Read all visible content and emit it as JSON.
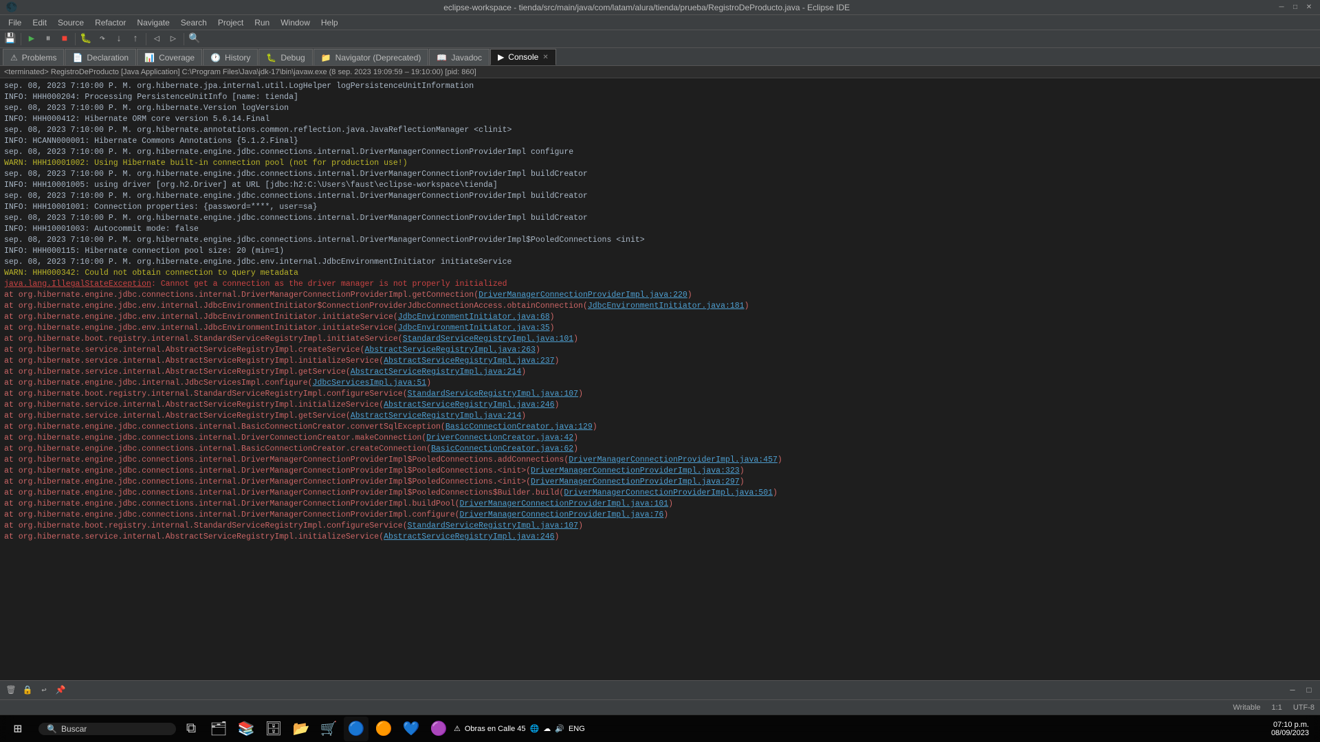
{
  "titlebar": {
    "title": "eclipse-workspace - tienda/src/main/java/com/latam/alura/tienda/prueba/RegistroDeProducto.java - Eclipse IDE",
    "minimize": "─",
    "maximize": "□",
    "close": "✕"
  },
  "menubar": {
    "items": [
      "File",
      "Edit",
      "Source",
      "Refactor",
      "Navigate",
      "Search",
      "Project",
      "Run",
      "Window",
      "Help"
    ]
  },
  "tabs": [
    {
      "id": "problems",
      "label": "Problems",
      "icon": "⚠",
      "active": false
    },
    {
      "id": "declaration",
      "label": "Declaration",
      "icon": "📄",
      "active": false
    },
    {
      "id": "coverage",
      "label": "Coverage",
      "icon": "📊",
      "active": false
    },
    {
      "id": "history",
      "label": "History",
      "icon": "🕐",
      "active": false
    },
    {
      "id": "debug",
      "label": "Debug",
      "icon": "🐛",
      "active": false
    },
    {
      "id": "navigator",
      "label": "Navigator (Deprecated)",
      "icon": "📁",
      "active": false
    },
    {
      "id": "javadoc",
      "label": "Javadoc",
      "icon": "📖",
      "active": false
    },
    {
      "id": "console",
      "label": "Console",
      "icon": "▶",
      "active": true
    }
  ],
  "process_bar": {
    "text": "<terminated> RegistroDeProducto [Java Application] C:\\Program Files\\Java\\jdk-17\\bin\\javaw.exe  (8 sep. 2023 19:09:59 – 19:10:00) [pid: 860]"
  },
  "console": {
    "lines": [
      {
        "type": "info",
        "text": "sep. 08, 2023 7:10:00 P. M. org.hibernate.jpa.internal.util.LogHelper logPersistenceUnitInformation"
      },
      {
        "type": "info",
        "text": "INFO: HHH000204: Processing PersistenceUnitInfo [name: tienda]"
      },
      {
        "type": "info",
        "text": "sep. 08, 2023 7:10:00 P. M. org.hibernate.Version logVersion"
      },
      {
        "type": "info",
        "text": "INFO: HHH000412: Hibernate ORM core version 5.6.14.Final"
      },
      {
        "type": "info",
        "text": "sep. 08, 2023 7:10:00 P. M. org.hibernate.annotations.common.reflection.java.JavaReflectionManager <clinit>"
      },
      {
        "type": "info",
        "text": "INFO: HCANN000001: Hibernate Commons Annotations {5.1.2.Final}"
      },
      {
        "type": "info",
        "text": "sep. 08, 2023 7:10:00 P. M. org.hibernate.engine.jdbc.connections.internal.DriverManagerConnectionProviderImpl configure"
      },
      {
        "type": "warn",
        "text": "WARN: HHH10001002: Using Hibernate built-in connection pool (not for production use!)"
      },
      {
        "type": "info",
        "text": "sep. 08, 2023 7:10:00 P. M. org.hibernate.engine.jdbc.connections.internal.DriverManagerConnectionProviderImpl buildCreator"
      },
      {
        "type": "info",
        "text": "INFO: HHH10001005: using driver [org.h2.Driver] at URL [jdbc:h2:C:\\Users\\faust\\eclipse-workspace\\tienda]"
      },
      {
        "type": "info",
        "text": "sep. 08, 2023 7:10:00 P. M. org.hibernate.engine.jdbc.connections.internal.DriverManagerConnectionProviderImpl buildCreator"
      },
      {
        "type": "info",
        "text": "INFO: HHH10001001: Connection properties: {password=****, user=sa}"
      },
      {
        "type": "info",
        "text": "sep. 08, 2023 7:10:00 P. M. org.hibernate.engine.jdbc.connections.internal.DriverManagerConnectionProviderImpl buildCreator"
      },
      {
        "type": "info",
        "text": "INFO: HHH10001003: Autocommit mode: false"
      },
      {
        "type": "info",
        "text": "sep. 08, 2023 7:10:00 P. M. org.hibernate.engine.jdbc.connections.internal.DriverManagerConnectionProviderImpl$PooledConnections <init>"
      },
      {
        "type": "info",
        "text": "INFO: HHH000115: Hibernate connection pool size: 20 (min=1)"
      },
      {
        "type": "info",
        "text": "sep. 08, 2023 7:10:00 P. M. org.hibernate.engine.jdbc.env.internal.JdbcEnvironmentInitiator initiateService"
      },
      {
        "type": "warn",
        "text": "WARN: HHH000342: Could not obtain connection to query metadata"
      },
      {
        "type": "error-header",
        "text": "java.lang.IllegalStateException: Cannot get a connection as the driver manager is not properly initialized"
      },
      {
        "type": "stack",
        "text": "    at org.hibernate.engine.jdbc.connections.internal.DriverManagerConnectionProviderImpl.getConnection(",
        "link": "DriverManagerConnectionProviderImpl.java:220",
        "suffix": ")"
      },
      {
        "type": "stack",
        "text": "    at org.hibernate.engine.jdbc.env.internal.JdbcEnvironmentInitiator$ConnectionProviderJdbcConnectionAccess.obtainConnection(",
        "link": "JdbcEnvironmentInitiator.java:181",
        "suffix": ")"
      },
      {
        "type": "stack",
        "text": "    at org.hibernate.engine.jdbc.env.internal.JdbcEnvironmentInitiator.initiateService(",
        "link": "JdbcEnvironmentInitiator.java:68",
        "suffix": ")"
      },
      {
        "type": "stack",
        "text": "    at org.hibernate.engine.jdbc.env.internal.JdbcEnvironmentInitiator.initiateService(",
        "link": "JdbcEnvironmentInitiator.java:35",
        "suffix": ")"
      },
      {
        "type": "stack",
        "text": "    at org.hibernate.boot.registry.internal.StandardServiceRegistryImpl.initiateService(",
        "link": "StandardServiceRegistryImpl.java:101",
        "suffix": ")"
      },
      {
        "type": "stack",
        "text": "    at org.hibernate.service.internal.AbstractServiceRegistryImpl.createService(",
        "link": "AbstractServiceRegistryImpl.java:263",
        "suffix": ")"
      },
      {
        "type": "stack",
        "text": "    at org.hibernate.service.internal.AbstractServiceRegistryImpl.initializeService(",
        "link": "AbstractServiceRegistryImpl.java:237",
        "suffix": ")"
      },
      {
        "type": "stack",
        "text": "    at org.hibernate.service.internal.AbstractServiceRegistryImpl.getService(",
        "link": "AbstractServiceRegistryImpl.java:214",
        "suffix": ")"
      },
      {
        "type": "stack",
        "text": "    at org.hibernate.engine.jdbc.internal.JdbcServicesImpl.configure(",
        "link": "JdbcServicesImpl.java:51",
        "suffix": ")"
      },
      {
        "type": "stack",
        "text": "    at org.hibernate.boot.registry.internal.StandardServiceRegistryImpl.configureService(",
        "link": "StandardServiceRegistryImpl.java:107",
        "suffix": ")"
      },
      {
        "type": "stack",
        "text": "    at org.hibernate.service.internal.AbstractServiceRegistryImpl.initializeService(",
        "link": "AbstractServiceRegistryImpl.java:246",
        "suffix": ")"
      },
      {
        "type": "stack",
        "text": "    at org.hibernate.service.internal.AbstractServiceRegistryImpl.getService(",
        "link": "AbstractServiceRegistryImpl.java:214",
        "suffix": ")"
      },
      {
        "type": "stack",
        "text": "    at org.hibernate.engine.jdbc.connections.internal.BasicConnectionCreator.convertSqlException(",
        "link": "BasicConnectionCreator.java:129",
        "suffix": ")"
      },
      {
        "type": "stack",
        "text": "    at org.hibernate.engine.jdbc.connections.internal.DriverConnectionCreator.makeConnection(",
        "link": "DriverConnectionCreator.java:42",
        "suffix": ")"
      },
      {
        "type": "stack",
        "text": "    at org.hibernate.engine.jdbc.connections.internal.BasicConnectionCreator.createConnection(",
        "link": "BasicConnectionCreator.java:62",
        "suffix": ")"
      },
      {
        "type": "stack",
        "text": "    at org.hibernate.engine.jdbc.connections.internal.DriverManagerConnectionProviderImpl$PooledConnections.addConnections(",
        "link": "DriverManagerConnectionProviderImpl.java:457",
        "suffix": ")"
      },
      {
        "type": "stack",
        "text": "    at org.hibernate.engine.jdbc.connections.internal.DriverManagerConnectionProviderImpl$PooledConnections.<init>(",
        "link": "DriverManagerConnectionProviderImpl.java:323",
        "suffix": ")"
      },
      {
        "type": "stack",
        "text": "    at org.hibernate.engine.jdbc.connections.internal.DriverManagerConnectionProviderImpl$PooledConnections.<init>(",
        "link": "DriverManagerConnectionProviderImpl.java:297",
        "suffix": ")"
      },
      {
        "type": "stack",
        "text": "    at org.hibernate.engine.jdbc.connections.internal.DriverManagerConnectionProviderImpl$PooledConnections$Builder.build(",
        "link": "DriverManagerConnectionProviderImpl.java:501",
        "suffix": ")"
      },
      {
        "type": "stack",
        "text": "    at org.hibernate.engine.jdbc.connections.internal.DriverManagerConnectionProviderImpl.buildPool(",
        "link": "DriverManagerConnectionProviderImpl.java:101",
        "suffix": ")"
      },
      {
        "type": "stack",
        "text": "    at org.hibernate.engine.jdbc.connections.internal.DriverManagerConnectionProviderImpl.configure(",
        "link": "DriverManagerConnectionProviderImpl.java:76",
        "suffix": ")"
      },
      {
        "type": "stack",
        "text": "    at org.hibernate.boot.registry.internal.StandardServiceRegistryImpl.configureService(",
        "link": "StandardServiceRegistryImpl.java:107",
        "suffix": ")"
      },
      {
        "type": "stack",
        "text": "    at org.hibernate.service.internal.AbstractServiceRegistryImpl.initializeService(",
        "link": "AbstractServiceRegistryImpl.java:246",
        "suffix": ")"
      }
    ]
  },
  "statusbar": {
    "text": "Writable",
    "position": "1:1",
    "encoding": "UTF-8"
  },
  "taskbar": {
    "start_icon": "⊞",
    "search_placeholder": "Buscar",
    "icons": [
      "🗂",
      "📚",
      "🗄",
      "📂",
      "🛒",
      "🔵",
      "🟠",
      "💜",
      "🟣"
    ],
    "systray": {
      "notification": "Obras en Calle 45",
      "time": "07:10 p.m.",
      "date": "08/09/2023",
      "language": "ENG"
    }
  }
}
